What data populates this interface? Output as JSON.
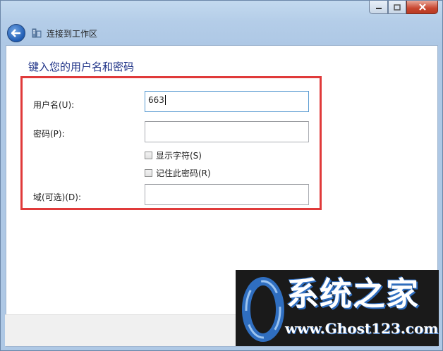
{
  "window": {
    "title": "连接到工作区"
  },
  "form": {
    "heading": "键入您的用户名和密码",
    "username_label": "用户名(U):",
    "username_value": "663",
    "password_label": "密码(P):",
    "password_value": "",
    "show_chars_label": "显示字符(S)",
    "show_chars_checked": false,
    "remember_label": "记住此密码(R)",
    "remember_checked": false,
    "domain_label": "域(可选)(D):",
    "domain_value": ""
  },
  "watermark": {
    "title": "系统之家",
    "url": "www.Ghost123.com"
  },
  "colors": {
    "highlight_border": "#e03a3a",
    "heading_text": "#1e3287",
    "watermark_bg": "#1a1a1a",
    "logo_blue": "#2f6ec0"
  }
}
